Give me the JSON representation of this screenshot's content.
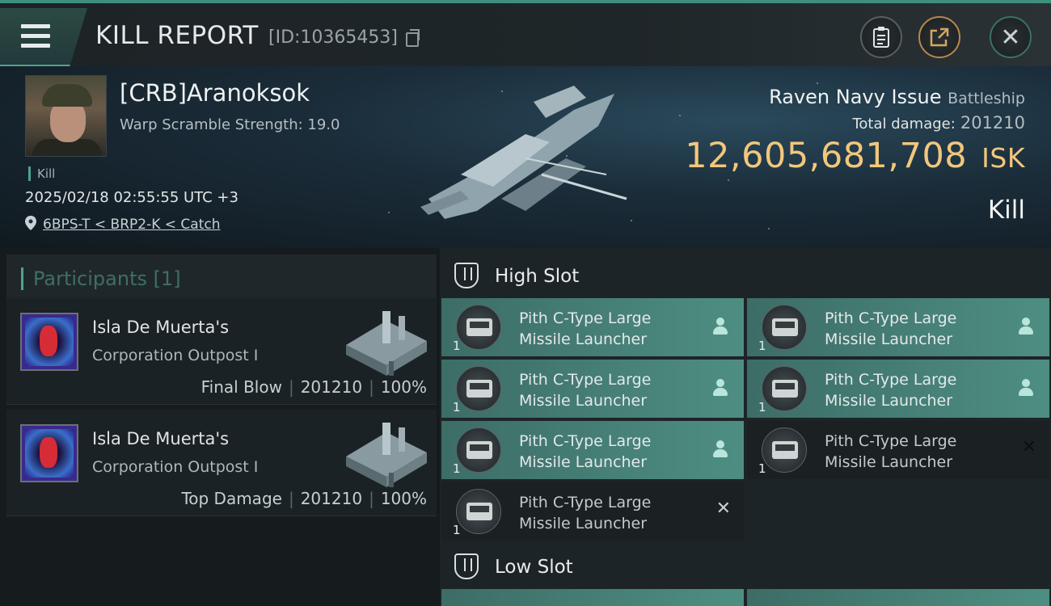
{
  "header": {
    "title": "KILL REPORT",
    "report_id": "[ID:10365453]"
  },
  "victim": {
    "name": "[CRB]Aranoksok",
    "warp_scramble": "Warp Scramble Strength: 19.0",
    "tag": "Kill",
    "datetime": "2025/02/18 02:55:55 UTC +3",
    "location": "6BPS-T < BRP2-K < Catch",
    "ship": "Raven Navy Issue",
    "ship_class": "Battleship",
    "total_damage_label": "Total damage:",
    "total_damage": "201210",
    "isk_value": "12,605,681,708",
    "isk_unit": "ISK",
    "result": "Kill"
  },
  "participants": {
    "title": "Participants [1]",
    "items": [
      {
        "name": "Isla De Muerta's",
        "corp": "Corporation Outpost I",
        "role": "Final Blow",
        "damage": "201210",
        "percent": "100%"
      },
      {
        "name": "Isla De Muerta's",
        "corp": "Corporation Outpost I",
        "role": "Top Damage",
        "damage": "201210",
        "percent": "100%"
      }
    ]
  },
  "fitting": {
    "high_slot_title": "High Slot",
    "low_slot_title": "Low Slot",
    "high_modules": [
      {
        "line1": "Pith C-Type Large",
        "line2": "Missile Launcher",
        "qty": "1",
        "status": "fitted"
      },
      {
        "line1": "Pith C-Type Large",
        "line2": "Missile Launcher",
        "qty": "1",
        "status": "fitted"
      },
      {
        "line1": "Pith C-Type Large",
        "line2": "Missile Launcher",
        "qty": "1",
        "status": "fitted"
      },
      {
        "line1": "Pith C-Type Large",
        "line2": "Missile Launcher",
        "qty": "1",
        "status": "fitted"
      },
      {
        "line1": "Pith C-Type Large",
        "line2": "Missile Launcher",
        "qty": "1",
        "status": "fitted"
      },
      {
        "line1": "Pith C-Type Large",
        "line2": "Missile Launcher",
        "qty": "1",
        "status": "destroyed"
      },
      {
        "line1": "Pith C-Type Large",
        "line2": "Missile Launcher",
        "qty": "1",
        "status": "destroyed"
      }
    ]
  },
  "colors": {
    "accent": "#4ea38f",
    "isk": "#f2c77c",
    "fitted_bg": "#4e8e82",
    "destroyed_bg": "#1b2022"
  }
}
